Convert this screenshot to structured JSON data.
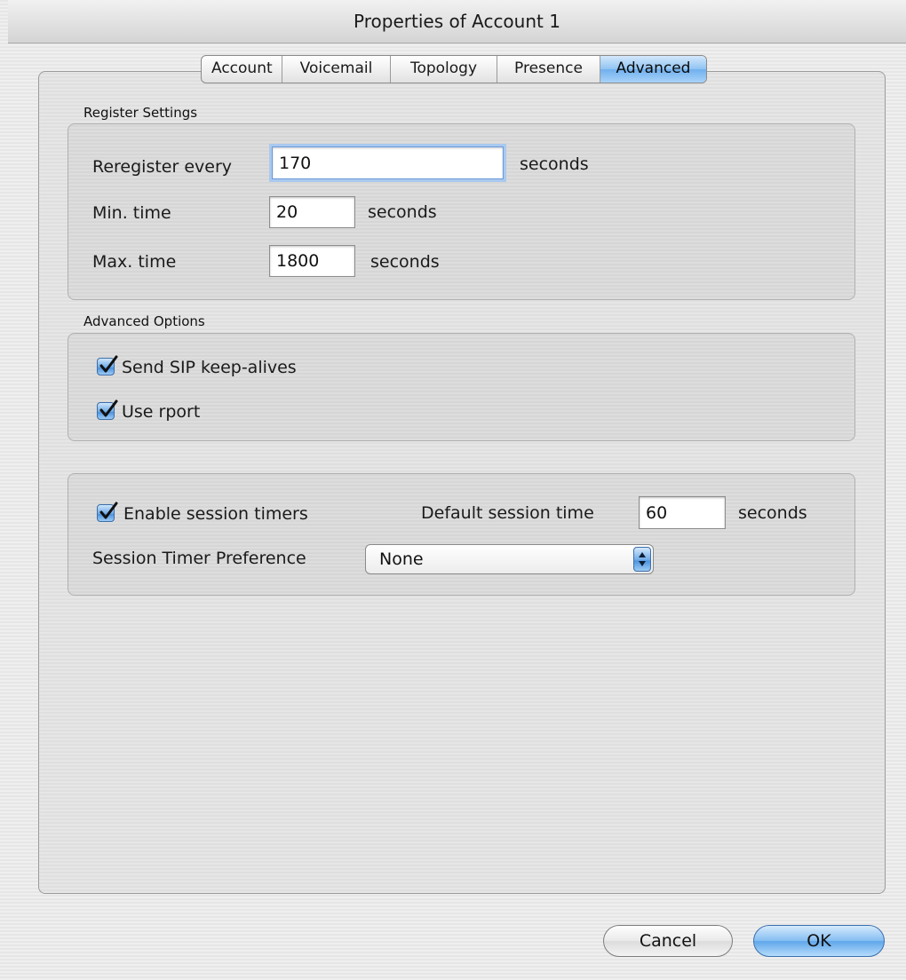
{
  "window": {
    "title": "Properties of Account 1"
  },
  "tabs": [
    {
      "label": "Account"
    },
    {
      "label": "Voicemail"
    },
    {
      "label": "Topology"
    },
    {
      "label": "Presence"
    },
    {
      "label": "Advanced",
      "selected": true
    }
  ],
  "register_settings": {
    "section_label": "Register Settings",
    "reregister": {
      "label": "Reregister every",
      "value": "170",
      "unit": "seconds"
    },
    "min_time": {
      "label": "Min. time",
      "value": "20",
      "unit": "seconds"
    },
    "max_time": {
      "label": "Max. time",
      "value": "1800",
      "unit": "seconds"
    }
  },
  "advanced_options": {
    "section_label": "Advanced Options",
    "send_keepalives": {
      "label": "Send SIP keep-alives",
      "checked": true
    },
    "use_rport": {
      "label": "Use rport",
      "checked": true
    }
  },
  "session": {
    "enable_timers": {
      "label": "Enable session timers",
      "checked": true
    },
    "default_time": {
      "label": "Default session time",
      "value": "60",
      "unit": "seconds"
    },
    "preference": {
      "label": "Session Timer Preference",
      "selected": "None"
    }
  },
  "buttons": {
    "cancel": "Cancel",
    "ok": "OK"
  },
  "colors": {
    "accent": "#6aa9e6",
    "selected_tab": "#8fc3f2"
  }
}
